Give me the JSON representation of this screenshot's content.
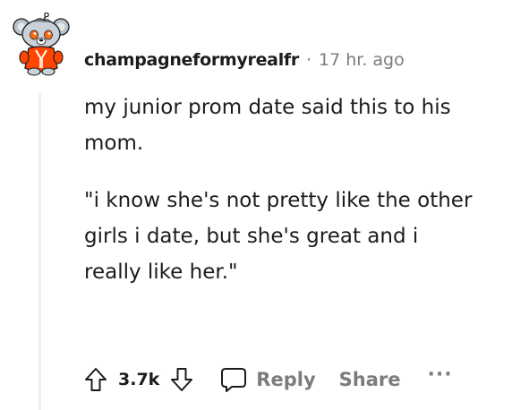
{
  "comment": {
    "username": "champagneformyrealfr",
    "separator": "·",
    "time": "17 hr. ago",
    "paragraphs": [
      "my junior prom date said this to his mom.",
      "\"i know she's not pretty like the other girls i date, but she's great and i really like her.\""
    ]
  },
  "actions": {
    "upvote_icon": "arrow-up-icon",
    "vote_count": "3.7k",
    "downvote_icon": "arrow-down-icon",
    "reply_icon": "speech-bubble-icon",
    "reply_label": "Reply",
    "share_label": "Share",
    "more_label": "···"
  },
  "colors": {
    "text": "#1c1c1c",
    "muted": "#7c7c7c",
    "thread_line": "#edeff1",
    "avatar_suit": "#ff4500"
  }
}
